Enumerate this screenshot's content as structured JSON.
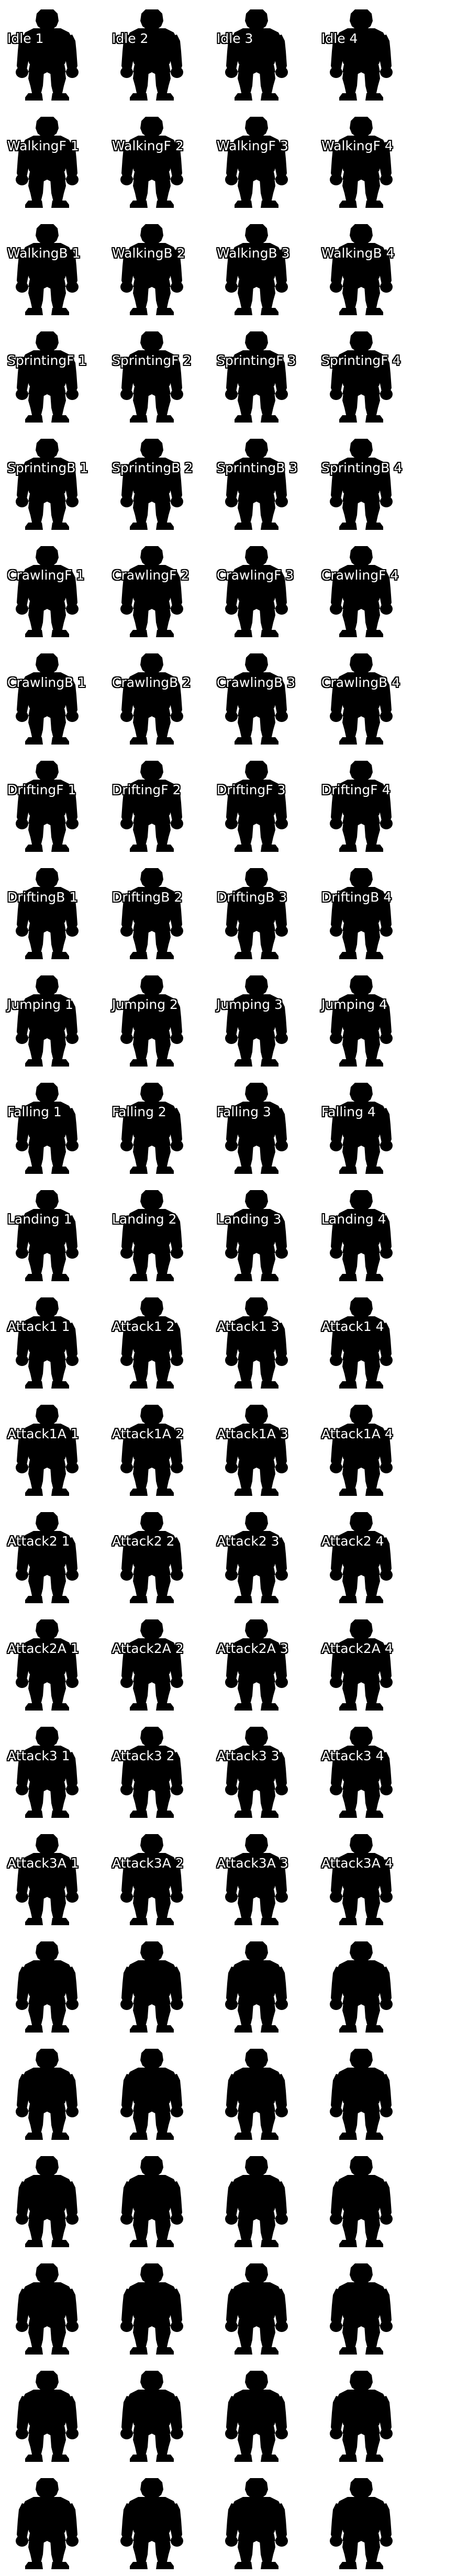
{
  "sheet": {
    "columns": 4,
    "rows": [
      [
        "Idle 1",
        "Idle 2",
        "Idle 3",
        "Idle 4"
      ],
      [
        "WalkingF 1",
        "WalkingF 2",
        "WalkingF 3",
        "WalkingF 4"
      ],
      [
        "WalkingB 1",
        "WalkingB 2",
        "WalkingB 3",
        "WalkingB 4"
      ],
      [
        "SprintingF 1",
        "SprintingF 2",
        "SprintingF 3",
        "SprintingF 4"
      ],
      [
        "SprintingB 1",
        "SprintingB 2",
        "SprintingB 3",
        "SprintingB 4"
      ],
      [
        "CrawlingF 1",
        "CrawlingF 2",
        "CrawlingF 3",
        "CrawlingF 4"
      ],
      [
        "CrawlingB 1",
        "CrawlingB 2",
        "CrawlingB 3",
        "CrawlingB 4"
      ],
      [
        "DriftingF 1",
        "DriftingF 2",
        "DriftingF 3",
        "DriftingF 4"
      ],
      [
        "DriftingB 1",
        "DriftingB 2",
        "DriftingB 3",
        "DriftingB 4"
      ],
      [
        "Jumping 1",
        "Jumping 2",
        "Jumping 3",
        "Jumping 4"
      ],
      [
        "Falling 1",
        "Falling 2",
        "Falling 3",
        "Falling 4"
      ],
      [
        "Landing 1",
        "Landing 2",
        "Landing 3",
        "Landing 4"
      ],
      [
        "Attack1 1",
        "Attack1 2",
        "Attack1 3",
        "Attack1 4"
      ],
      [
        "Attack1A 1",
        "Attack1A 2",
        "Attack1A 3",
        "Attack1A 4"
      ],
      [
        "Attack2 1",
        "Attack2 2",
        "Attack2 3",
        "Attack2 4"
      ],
      [
        "Attack2A 1",
        "Attack2A 2",
        "Attack2A 3",
        "Attack2A 4"
      ],
      [
        "Attack3 1",
        "Attack3 2",
        "Attack3 3",
        "Attack3 4"
      ],
      [
        "Attack3A 1",
        "Attack3A 2",
        "Attack3A 3",
        "Attack3A 4"
      ],
      [
        "",
        "",
        "",
        ""
      ],
      [
        "",
        "",
        "",
        ""
      ],
      [
        "",
        "",
        "",
        ""
      ],
      [
        "",
        "",
        "",
        ""
      ],
      [
        "",
        "",
        "",
        ""
      ],
      [
        "",
        "",
        "",
        ""
      ]
    ],
    "sprite_icon": "brawler-silhouette-icon",
    "colors": {
      "background": "#ffffff",
      "silhouette": "#000000",
      "label_text": "#ffffff",
      "label_outline": "#000000"
    }
  }
}
